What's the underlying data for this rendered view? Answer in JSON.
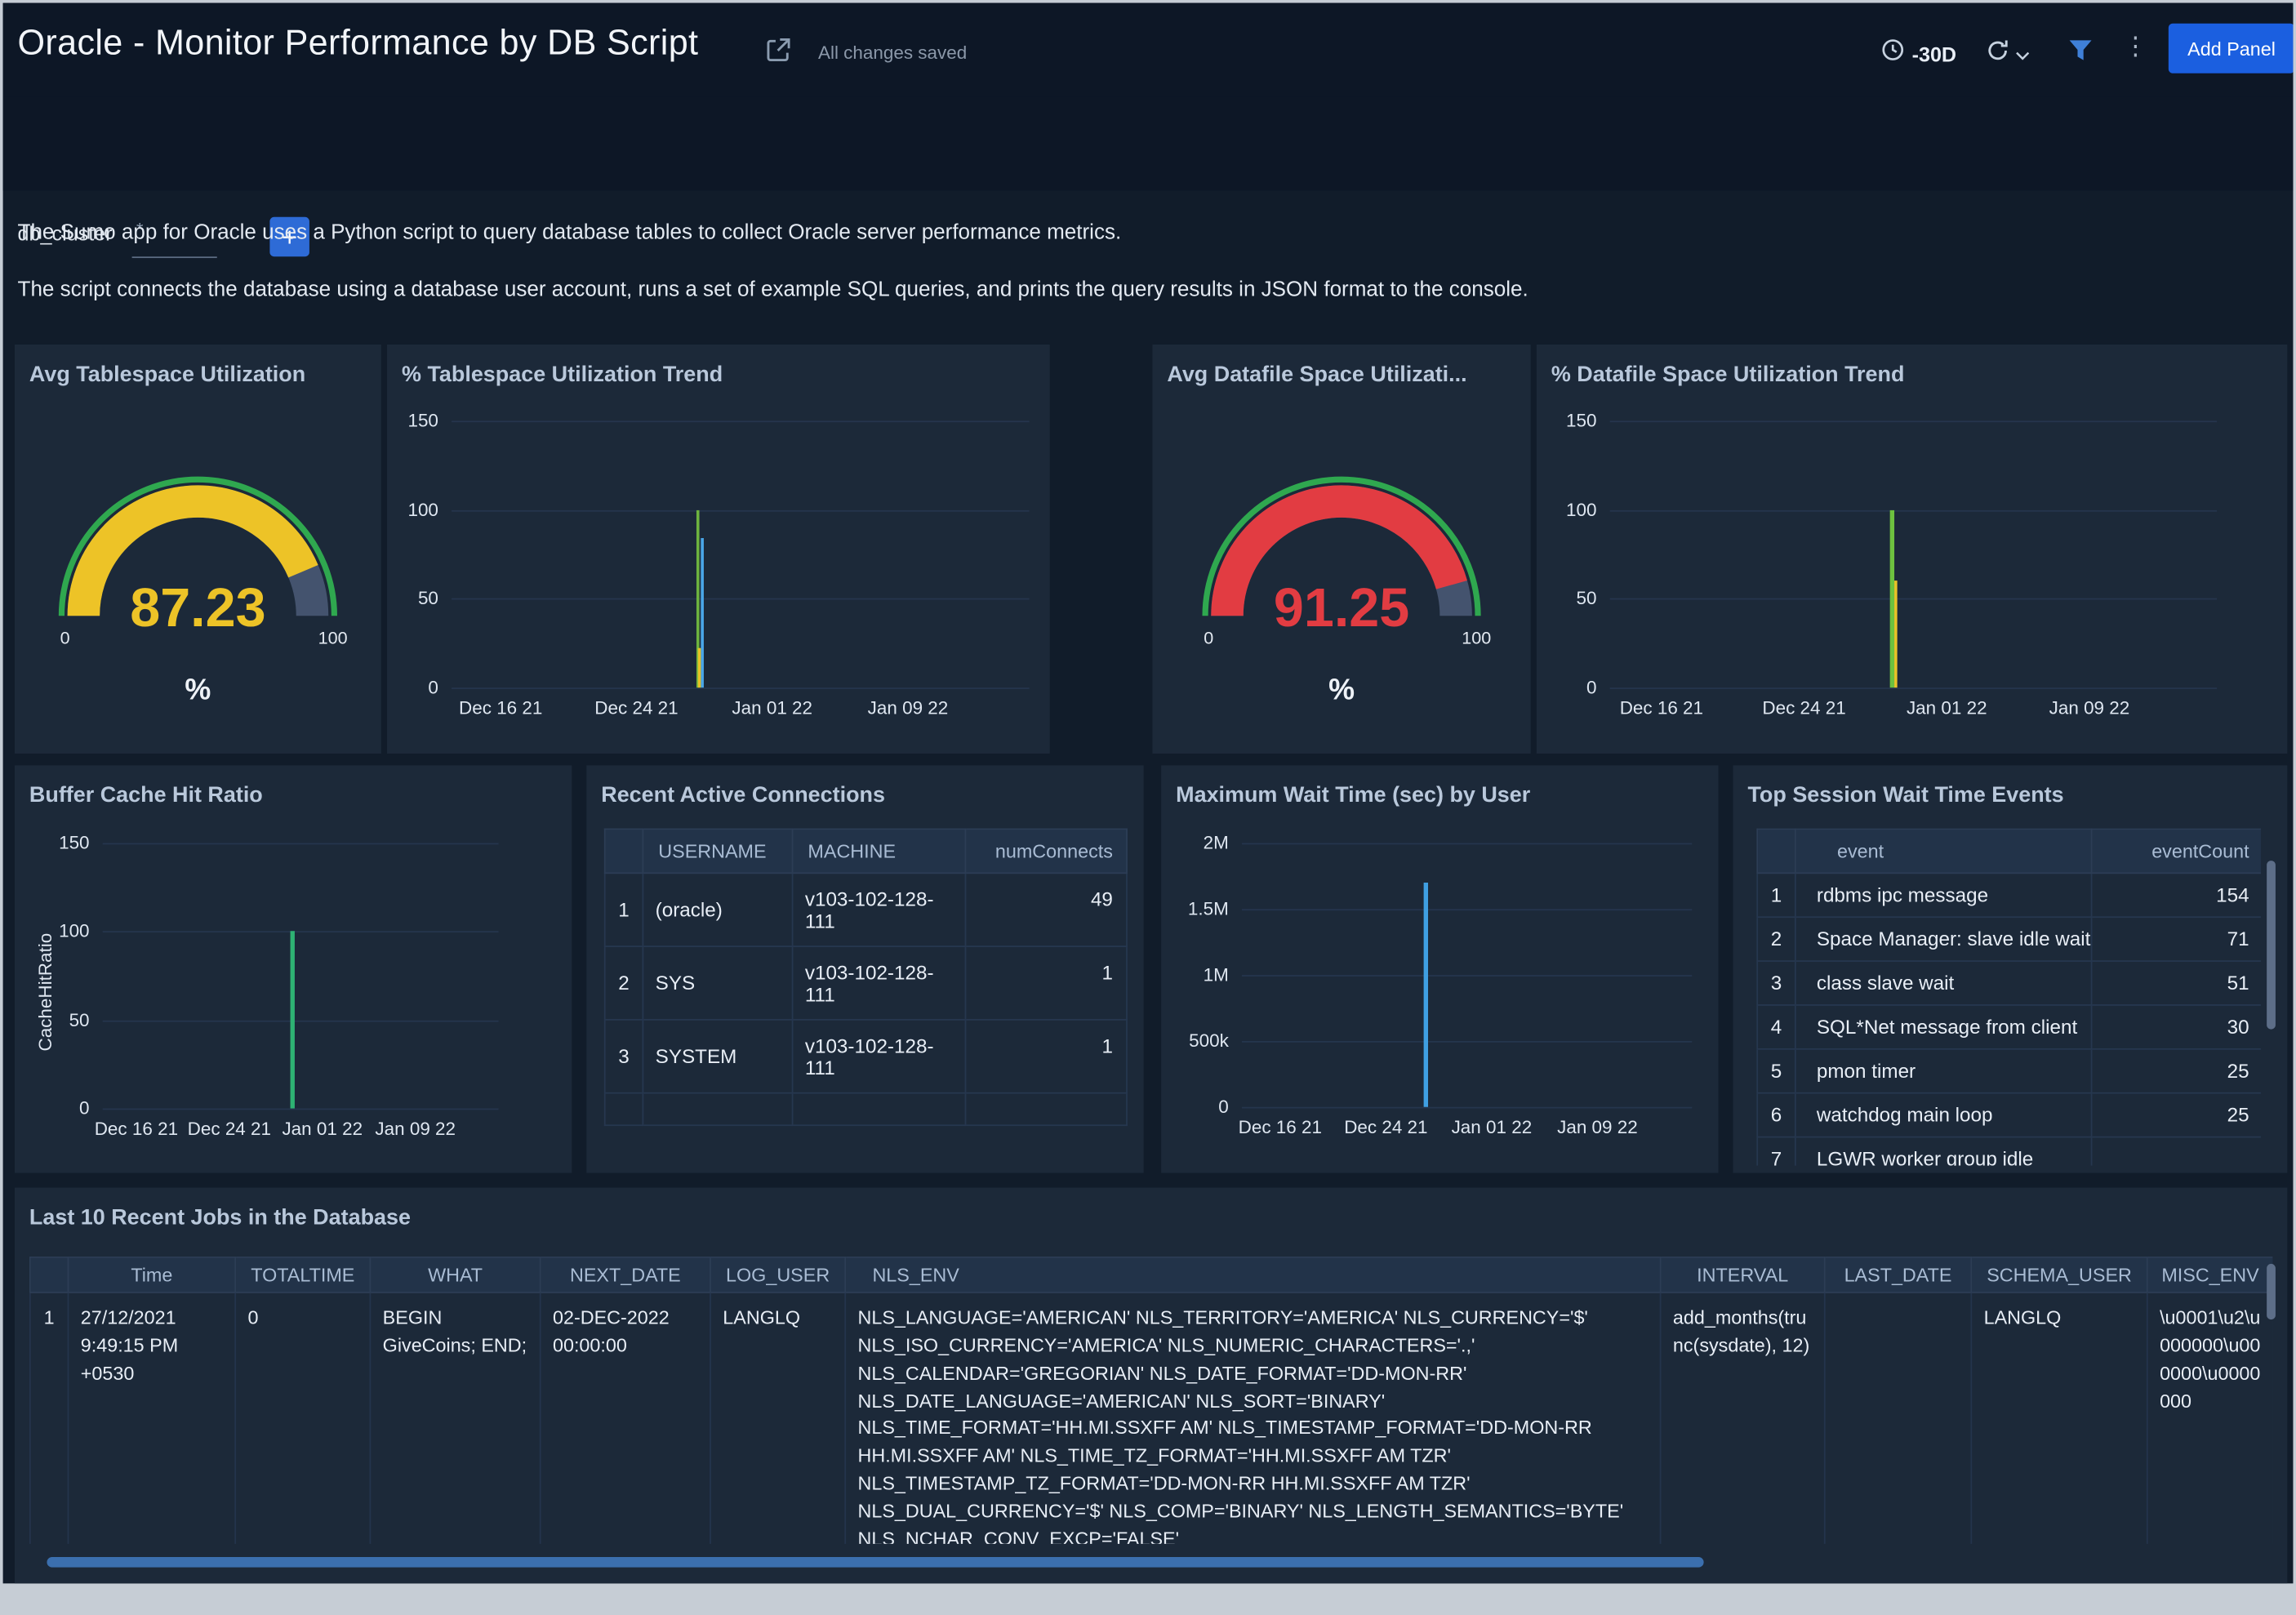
{
  "header": {
    "title": "Oracle - Monitor Performance by DB Script",
    "saved_status": "All changes saved",
    "time_range": "-30D",
    "add_panel_label": "Add Panel"
  },
  "filter": {
    "label": "db_cluster",
    "required_mark": "*",
    "value": "",
    "add_filter_label": "+"
  },
  "description": {
    "line1": "The Sumo app for Oracle uses a Python script to query database tables to collect Oracle server performance metrics.",
    "line2": "The script connects the database using a database user account, runs a set of example SQL queries, and prints the query results in JSON format to the console."
  },
  "panels": {
    "gauge1": {
      "title": "Avg Tablespace Utilization",
      "display_value": "87.23",
      "value": 87.23,
      "unit": "%",
      "min_label": "0",
      "max_label": "100",
      "color": "#edc327",
      "rim_color": "#2fa84f",
      "track_color": "#44536e"
    },
    "trend1": {
      "title": "% Tablespace Utilization Trend",
      "chart": {
        "type": "line",
        "ymax": 150,
        "y_ticks": [
          {
            "v": 150,
            "label": "150"
          },
          {
            "v": 100,
            "label": "100"
          },
          {
            "v": 50,
            "label": "50"
          },
          {
            "v": 0,
            "label": "0"
          }
        ],
        "x_labels": [
          "Dec 16 21",
          "Dec 24 21",
          "Jan 01 22",
          "Jan 09 22"
        ],
        "spikes": [
          {
            "frac": 0.423,
            "v": 100,
            "color": "#6db33f",
            "w": 2.5
          },
          {
            "frac": 0.431,
            "v": 84,
            "color": "#4aa6e8",
            "w": 2.5
          },
          {
            "frac": 0.427,
            "v": 22,
            "color": "#e8c227",
            "w": 2
          }
        ]
      }
    },
    "gauge2": {
      "title": "Avg Datafile Space Utilizati...",
      "display_value": "91.25",
      "value": 91.25,
      "unit": "%",
      "min_label": "0",
      "max_label": "100",
      "color": "#e23c42",
      "rim_color": "#2fa84f",
      "track_color": "#44536e"
    },
    "trend2": {
      "title": "% Datafile Space Utilization Trend",
      "chart": {
        "type": "line",
        "ymax": 150,
        "y_ticks": [
          {
            "v": 150,
            "label": "150"
          },
          {
            "v": 100,
            "label": "100"
          },
          {
            "v": 50,
            "label": "50"
          },
          {
            "v": 0,
            "label": "0"
          }
        ],
        "x_labels": [
          "Dec 16 21",
          "Dec 24 21",
          "Jan 01 22",
          "Jan 09 22"
        ],
        "spikes": [
          {
            "frac": 0.462,
            "v": 100,
            "color": "#6dc13f",
            "w": 2.5
          },
          {
            "frac": 0.468,
            "v": 60,
            "color": "#e8c227",
            "w": 2.5
          }
        ]
      }
    },
    "buffer": {
      "title": "Buffer Cache Hit Ratio",
      "ylabel": "CacheHitRatio",
      "chart": {
        "type": "line",
        "ymax": 150,
        "y_ticks": [
          {
            "v": 150,
            "label": "150"
          },
          {
            "v": 100,
            "label": "100"
          },
          {
            "v": 50,
            "label": "50"
          },
          {
            "v": 0,
            "label": "0"
          }
        ],
        "x_labels": [
          "Dec 16 21",
          "Dec 24 21",
          "Jan 01 22",
          "Jan 09 22"
        ],
        "spikes": [
          {
            "frac": 0.475,
            "v": 100,
            "color": "#2eb273",
            "w": 2.5
          }
        ]
      }
    },
    "connections": {
      "title": "Recent Active Connections",
      "columns": [
        "USERNAME",
        "MACHINE",
        "numConnects"
      ],
      "rows": [
        {
          "num": "1",
          "username": "(oracle)",
          "machine": "v103-102-128-111",
          "numConnects": "49"
        },
        {
          "num": "2",
          "username": "SYS",
          "machine": "v103-102-128-111",
          "numConnects": "1"
        },
        {
          "num": "3",
          "username": "SYSTEM",
          "machine": "v103-102-128-111",
          "numConnects": "1"
        }
      ]
    },
    "max_wait": {
      "title": "Maximum Wait Time (sec) by User",
      "chart": {
        "type": "line",
        "ymax": 2000000,
        "y_ticks": [
          {
            "v": 2000000,
            "label": "2M"
          },
          {
            "v": 1500000,
            "label": "1.5M"
          },
          {
            "v": 1000000,
            "label": "1M"
          },
          {
            "v": 500000,
            "label": "500k"
          },
          {
            "v": 0,
            "label": "0"
          }
        ],
        "x_labels": [
          "Dec 16 21",
          "Dec 24 21",
          "Jan 01 22",
          "Jan 09 22"
        ],
        "spikes": [
          {
            "frac": 0.405,
            "v": 1700000,
            "color": "#3f9fe2",
            "w": 2.5
          }
        ]
      }
    },
    "wait_events": {
      "title": "Top Session Wait Time Events",
      "columns": [
        "event",
        "eventCount"
      ],
      "rows": [
        {
          "num": "1",
          "event": "rdbms ipc message",
          "count": "154"
        },
        {
          "num": "2",
          "event": "Space Manager: slave idle wait",
          "count": "71"
        },
        {
          "num": "3",
          "event": "class slave wait",
          "count": "51"
        },
        {
          "num": "4",
          "event": "SQL*Net message from client",
          "count": "30"
        },
        {
          "num": "5",
          "event": "pmon timer",
          "count": "25"
        },
        {
          "num": "6",
          "event": "watchdog main loop",
          "count": "25"
        },
        {
          "num": "7",
          "event": "LGWR worker group idle",
          "count": ""
        }
      ]
    },
    "jobs": {
      "title": "Last 10 Recent Jobs in the Database",
      "columns": [
        "Time",
        "TOTALTIME",
        "WHAT",
        "NEXT_DATE",
        "LOG_USER",
        "NLS_ENV",
        "INTERVAL",
        "LAST_DATE",
        "SCHEMA_USER",
        "MISC_ENV"
      ],
      "row": {
        "num": "1",
        "time": "27/12/2021 9:49:15 PM +0530",
        "totaltime": "0",
        "what": "BEGIN GiveCoins; END;",
        "next_date": "02-DEC-2022 00:00:00",
        "log_user": "LANGLQ",
        "nls_env": "NLS_LANGUAGE='AMERICAN' NLS_TERRITORY='AMERICA' NLS_CURRENCY='$' NLS_ISO_CURRENCY='AMERICA' NLS_NUMERIC_CHARACTERS='.,' NLS_CALENDAR='GREGORIAN' NLS_DATE_FORMAT='DD-MON-RR' NLS_DATE_LANGUAGE='AMERICAN' NLS_SORT='BINARY' NLS_TIME_FORMAT='HH.MI.SSXFF AM' NLS_TIMESTAMP_FORMAT='DD-MON-RR HH.MI.SSXFF AM' NLS_TIME_TZ_FORMAT='HH.MI.SSXFF AM TZR' NLS_TIMESTAMP_TZ_FORMAT='DD-MON-RR HH.MI.SSXFF AM TZR' NLS_DUAL_CURRENCY='$' NLS_COMP='BINARY' NLS_LENGTH_SEMANTICS='BYTE' NLS_NCHAR_CONV_EXCP='FALSE'",
        "interval": "add_months(trunc(sysdate), 12)",
        "last_date": "",
        "schema_user": "LANGLQ",
        "misc_env": "\\u0001\\u2\\u000000\\u000000\\u0000000"
      }
    }
  }
}
